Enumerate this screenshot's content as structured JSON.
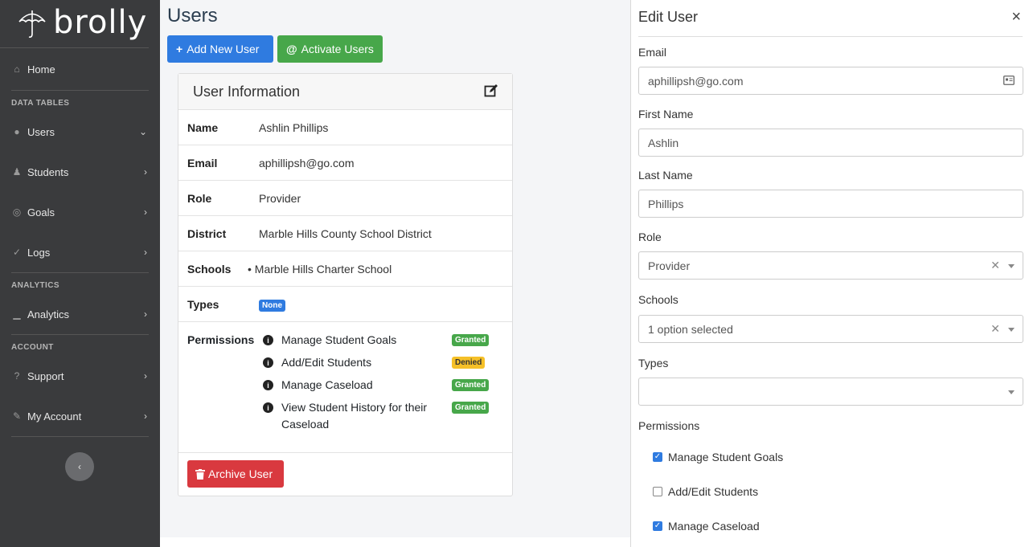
{
  "brand": {
    "name": "brolly"
  },
  "sidebar": {
    "home": "Home",
    "sections": {
      "data_tables": "DATA TABLES",
      "analytics": "ANALYTICS",
      "account": "ACCOUNT"
    },
    "items": {
      "users": "Users",
      "students": "Students",
      "goals": "Goals",
      "logs": "Logs",
      "analytics": "Analytics",
      "support": "Support",
      "my_account": "My Account"
    }
  },
  "main": {
    "title": "Users",
    "add_user": "Add New User",
    "activate_users": "Activate Users",
    "card_title": "User Information",
    "fields": {
      "name_label": "Name",
      "name": "Ashlin Phillips",
      "email_label": "Email",
      "email": "aphillipsh@go.com",
      "role_label": "Role",
      "role": "Provider",
      "district_label": "District",
      "district": "Marble Hills County School District",
      "schools_label": "Schools",
      "school": "Marble Hills Charter School",
      "types_label": "Types",
      "types_badge": "None",
      "permissions_label": "Permissions"
    },
    "permissions": [
      {
        "name": "Manage Student Goals",
        "status": "Granted"
      },
      {
        "name": "Add/Edit Students",
        "status": "Denied"
      },
      {
        "name": "Manage Caseload",
        "status": "Granted"
      },
      {
        "name": "View Student History for their Caseload",
        "status": "Granted"
      }
    ],
    "archive": "Archive User"
  },
  "panel": {
    "title": "Edit User",
    "close": "×",
    "email_label": "Email",
    "email_value": "aphillipsh@go.com",
    "first_label": "First Name",
    "first_value": "Ashlin",
    "last_label": "Last Name",
    "last_value": "Phillips",
    "role_label": "Role",
    "role_value": "Provider",
    "schools_label": "Schools",
    "schools_value": "1 option selected",
    "types_label": "Types",
    "permissions_label": "Permissions",
    "checks": [
      {
        "label": "Manage Student Goals",
        "checked": true
      },
      {
        "label": "Add/Edit Students",
        "checked": false
      },
      {
        "label": "Manage Caseload",
        "checked": true
      }
    ]
  },
  "colors": {
    "primary": "#2f7be0",
    "success": "#47a74a",
    "danger": "#d9393f",
    "warning": "#f5c028",
    "sidebar": "#3a3b3d"
  }
}
